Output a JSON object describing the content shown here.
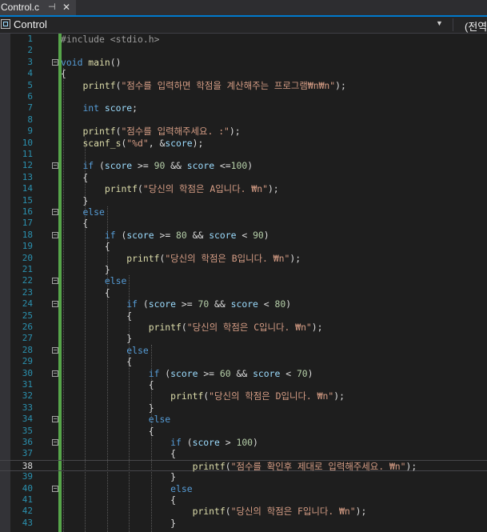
{
  "tab": {
    "title": "Control.c",
    "pin": "⊣",
    "close": "✕"
  },
  "navbar": {
    "project": "Control",
    "arrow": "▼",
    "right": "(전역"
  },
  "colors": {
    "keyword": "#569cd6",
    "string": "#d69d85",
    "plain": "#dcdcdc",
    "macro": "#9b9b9b",
    "identifier": "#9cdcfe",
    "function": "#dcdcaa",
    "number": "#b5cea8",
    "linenum": "#2b91af"
  },
  "current_line": 38,
  "lines": [
    {
      "n": "1",
      "tokens": [
        {
          "t": "#include <stdio.h>",
          "c": "macro"
        }
      ]
    },
    {
      "n": "2",
      "tokens": []
    },
    {
      "n": "3",
      "tokens": [
        {
          "t": "void",
          "c": "keyword"
        },
        {
          "t": " "
        },
        {
          "t": "main",
          "c": "function"
        },
        {
          "t": "()"
        }
      ],
      "fold": "−"
    },
    {
      "n": "4",
      "tokens": [
        {
          "t": "{"
        }
      ]
    },
    {
      "n": "5",
      "tokens": [
        {
          "t": "    "
        },
        {
          "t": "printf",
          "c": "function"
        },
        {
          "t": "("
        },
        {
          "t": "\"점수를 입력하면 학점을 계산해주는 프로그램₩n₩n\"",
          "c": "string"
        },
        {
          "t": ");"
        }
      ]
    },
    {
      "n": "6",
      "tokens": []
    },
    {
      "n": "7",
      "tokens": [
        {
          "t": "    "
        },
        {
          "t": "int",
          "c": "keyword"
        },
        {
          "t": " "
        },
        {
          "t": "score",
          "c": "identifier"
        },
        {
          "t": ";"
        }
      ]
    },
    {
      "n": "8",
      "tokens": []
    },
    {
      "n": "9",
      "tokens": [
        {
          "t": "    "
        },
        {
          "t": "printf",
          "c": "function"
        },
        {
          "t": "("
        },
        {
          "t": "\"점수를 입력해주세요. :\"",
          "c": "string"
        },
        {
          "t": ");"
        }
      ]
    },
    {
      "n": "10",
      "tokens": [
        {
          "t": "    "
        },
        {
          "t": "scanf_s",
          "c": "function"
        },
        {
          "t": "("
        },
        {
          "t": "\"%d\"",
          "c": "string"
        },
        {
          "t": ", &"
        },
        {
          "t": "score",
          "c": "identifier"
        },
        {
          "t": ");"
        }
      ]
    },
    {
      "n": "11",
      "tokens": []
    },
    {
      "n": "12",
      "tokens": [
        {
          "t": "    "
        },
        {
          "t": "if",
          "c": "keyword"
        },
        {
          "t": " ("
        },
        {
          "t": "score",
          "c": "identifier"
        },
        {
          "t": " >= "
        },
        {
          "t": "90",
          "c": "number"
        },
        {
          "t": " && "
        },
        {
          "t": "score",
          "c": "identifier"
        },
        {
          "t": " <="
        },
        {
          "t": "100",
          "c": "number"
        },
        {
          "t": ")"
        }
      ],
      "fold": "−"
    },
    {
      "n": "13",
      "tokens": [
        {
          "t": "    {"
        }
      ]
    },
    {
      "n": "14",
      "tokens": [
        {
          "t": "        "
        },
        {
          "t": "printf",
          "c": "function"
        },
        {
          "t": "("
        },
        {
          "t": "\"당신의 학점은 A입니다. ₩n\"",
          "c": "string"
        },
        {
          "t": ");"
        }
      ]
    },
    {
      "n": "15",
      "tokens": [
        {
          "t": "    }"
        }
      ]
    },
    {
      "n": "16",
      "tokens": [
        {
          "t": "    "
        },
        {
          "t": "else",
          "c": "keyword"
        }
      ],
      "fold": "−"
    },
    {
      "n": "17",
      "tokens": [
        {
          "t": "    {"
        }
      ]
    },
    {
      "n": "18",
      "tokens": [
        {
          "t": "        "
        },
        {
          "t": "if",
          "c": "keyword"
        },
        {
          "t": " ("
        },
        {
          "t": "score",
          "c": "identifier"
        },
        {
          "t": " >= "
        },
        {
          "t": "80",
          "c": "number"
        },
        {
          "t": " && "
        },
        {
          "t": "score",
          "c": "identifier"
        },
        {
          "t": " < "
        },
        {
          "t": "90",
          "c": "number"
        },
        {
          "t": ")"
        }
      ],
      "fold": "−"
    },
    {
      "n": "19",
      "tokens": [
        {
          "t": "        {"
        }
      ]
    },
    {
      "n": "20",
      "tokens": [
        {
          "t": "            "
        },
        {
          "t": "printf",
          "c": "function"
        },
        {
          "t": "("
        },
        {
          "t": "\"당신의 학점은 B입니다. ₩n\"",
          "c": "string"
        },
        {
          "t": ");"
        }
      ]
    },
    {
      "n": "21",
      "tokens": [
        {
          "t": "        }"
        }
      ]
    },
    {
      "n": "22",
      "tokens": [
        {
          "t": "        "
        },
        {
          "t": "else",
          "c": "keyword"
        }
      ],
      "fold": "−"
    },
    {
      "n": "23",
      "tokens": [
        {
          "t": "        {"
        }
      ]
    },
    {
      "n": "24",
      "tokens": [
        {
          "t": "            "
        },
        {
          "t": "if",
          "c": "keyword"
        },
        {
          "t": " ("
        },
        {
          "t": "score",
          "c": "identifier"
        },
        {
          "t": " >= "
        },
        {
          "t": "70",
          "c": "number"
        },
        {
          "t": " && "
        },
        {
          "t": "score",
          "c": "identifier"
        },
        {
          "t": " < "
        },
        {
          "t": "80",
          "c": "number"
        },
        {
          "t": ")"
        }
      ],
      "fold": "−"
    },
    {
      "n": "25",
      "tokens": [
        {
          "t": "            {"
        }
      ]
    },
    {
      "n": "26",
      "tokens": [
        {
          "t": "                "
        },
        {
          "t": "printf",
          "c": "function"
        },
        {
          "t": "("
        },
        {
          "t": "\"당신의 학점은 C입니다. ₩n\"",
          "c": "string"
        },
        {
          "t": ");"
        }
      ]
    },
    {
      "n": "27",
      "tokens": [
        {
          "t": "            }"
        }
      ]
    },
    {
      "n": "28",
      "tokens": [
        {
          "t": "            "
        },
        {
          "t": "else",
          "c": "keyword"
        }
      ],
      "fold": "−"
    },
    {
      "n": "29",
      "tokens": [
        {
          "t": "            {"
        }
      ]
    },
    {
      "n": "30",
      "tokens": [
        {
          "t": "                "
        },
        {
          "t": "if",
          "c": "keyword"
        },
        {
          "t": " ("
        },
        {
          "t": "score",
          "c": "identifier"
        },
        {
          "t": " >= "
        },
        {
          "t": "60",
          "c": "number"
        },
        {
          "t": " && "
        },
        {
          "t": "score",
          "c": "identifier"
        },
        {
          "t": " < "
        },
        {
          "t": "70",
          "c": "number"
        },
        {
          "t": ")"
        }
      ],
      "fold": "−"
    },
    {
      "n": "31",
      "tokens": [
        {
          "t": "                {"
        }
      ]
    },
    {
      "n": "32",
      "tokens": [
        {
          "t": "                    "
        },
        {
          "t": "printf",
          "c": "function"
        },
        {
          "t": "("
        },
        {
          "t": "\"당신의 학점은 D입니다. ₩n\"",
          "c": "string"
        },
        {
          "t": ");"
        }
      ]
    },
    {
      "n": "33",
      "tokens": [
        {
          "t": "                }"
        }
      ]
    },
    {
      "n": "34",
      "tokens": [
        {
          "t": "                "
        },
        {
          "t": "else",
          "c": "keyword"
        }
      ],
      "fold": "−"
    },
    {
      "n": "35",
      "tokens": [
        {
          "t": "                {"
        }
      ]
    },
    {
      "n": "36",
      "tokens": [
        {
          "t": "                    "
        },
        {
          "t": "if",
          "c": "keyword"
        },
        {
          "t": " ("
        },
        {
          "t": "score",
          "c": "identifier"
        },
        {
          "t": " > "
        },
        {
          "t": "100",
          "c": "number"
        },
        {
          "t": ")"
        }
      ],
      "fold": "−"
    },
    {
      "n": "37",
      "tokens": [
        {
          "t": "                    {"
        }
      ]
    },
    {
      "n": "38",
      "tokens": [
        {
          "t": "                        "
        },
        {
          "t": "printf",
          "c": "function"
        },
        {
          "t": "("
        },
        {
          "t": "\"점수를 확인후 제대로 입력해주세요. ₩n\"",
          "c": "string"
        },
        {
          "t": ");"
        }
      ]
    },
    {
      "n": "39",
      "tokens": [
        {
          "t": "                    }"
        }
      ]
    },
    {
      "n": "40",
      "tokens": [
        {
          "t": "                    "
        },
        {
          "t": "else",
          "c": "keyword"
        }
      ],
      "fold": "−"
    },
    {
      "n": "41",
      "tokens": [
        {
          "t": "                    {"
        }
      ]
    },
    {
      "n": "42",
      "tokens": [
        {
          "t": "                        "
        },
        {
          "t": "printf",
          "c": "function"
        },
        {
          "t": "("
        },
        {
          "t": "\"당신의 학점은 F입니다. ₩n\"",
          "c": "string"
        },
        {
          "t": ");"
        }
      ]
    },
    {
      "n": "43",
      "tokens": [
        {
          "t": "                    }"
        }
      ]
    }
  ]
}
